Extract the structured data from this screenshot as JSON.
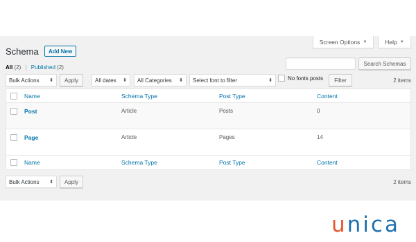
{
  "header": {
    "screen_options": "Screen Options",
    "help": "Help",
    "title": "Schema",
    "add_new": "Add New"
  },
  "filters": {
    "all": "All",
    "all_count": "(2)",
    "separator": "|",
    "published": "Published",
    "published_count": "(2)"
  },
  "search": {
    "value": "",
    "button": "Search Schemas"
  },
  "toolbar_top": {
    "bulk_actions": "Bulk Actions",
    "apply": "Apply",
    "dates": "All dates",
    "categories": "All Categories",
    "font": "Select font to filter",
    "no_fonts_label": "No fonts posts",
    "filter": "Filter",
    "item_count": "2 items"
  },
  "table": {
    "columns": [
      "Name",
      "Schema Type",
      "Post Type",
      "Content"
    ],
    "rows": [
      {
        "name": "Post",
        "schema_type": "Article",
        "post_type": "Posts",
        "content": "0"
      },
      {
        "name": "Page",
        "schema_type": "Article",
        "post_type": "Pages",
        "content": "14"
      }
    ]
  },
  "toolbar_bottom": {
    "bulk_actions": "Bulk Actions",
    "apply": "Apply",
    "item_count": "2 items"
  },
  "watermark": {
    "letter_1": "u",
    "letter_rest": "nica"
  },
  "colors": {
    "link": "#0073aa",
    "admin_bg": "#f1f1f1",
    "logo_orange": "#e8572e",
    "logo_blue": "#1d6fb0"
  }
}
